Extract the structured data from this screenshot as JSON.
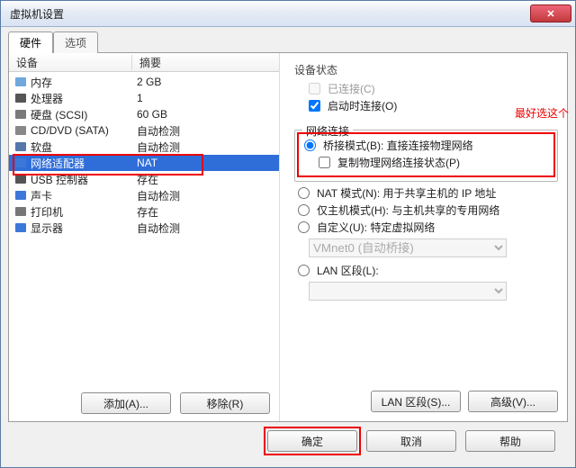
{
  "window": {
    "title": "虚拟机设置"
  },
  "tabs": [
    {
      "label": "硬件",
      "active": true
    },
    {
      "label": "选项",
      "active": false
    }
  ],
  "hardware_list": {
    "headers": {
      "device": "设备",
      "summary": "摘要"
    },
    "rows": [
      {
        "icon": "memory-icon",
        "name": "内存",
        "summary": "2 GB"
      },
      {
        "icon": "cpu-icon",
        "name": "处理器",
        "summary": "1"
      },
      {
        "icon": "disk-icon",
        "name": "硬盘 (SCSI)",
        "summary": "60 GB"
      },
      {
        "icon": "cd-icon",
        "name": "CD/DVD (SATA)",
        "summary": "自动检测"
      },
      {
        "icon": "floppy-icon",
        "name": "软盘",
        "summary": "自动检测"
      },
      {
        "icon": "nic-icon",
        "name": "网络适配器",
        "summary": "NAT",
        "selected": true
      },
      {
        "icon": "usb-icon",
        "name": "USB 控制器",
        "summary": "存在"
      },
      {
        "icon": "sound-icon",
        "name": "声卡",
        "summary": "自动检测"
      },
      {
        "icon": "printer-icon",
        "name": "打印机",
        "summary": "存在"
      },
      {
        "icon": "display-icon",
        "name": "显示器",
        "summary": "自动检测"
      }
    ],
    "buttons": {
      "add": "添加(A)...",
      "remove": "移除(R)"
    }
  },
  "right": {
    "device_state": {
      "title": "设备状态",
      "connected": {
        "label": "已连接(C)",
        "checked": false,
        "enabled": false
      },
      "connect_at_power": {
        "label": "启动时连接(O)",
        "checked": true
      }
    },
    "network": {
      "title": "网络连接",
      "annotation": "最好选这个",
      "bridged": {
        "label": "桥接模式(B): 直接连接物理网络",
        "selected": true
      },
      "replicate": {
        "label": "复制物理网络连接状态(P)",
        "checked": false
      },
      "nat": {
        "label": "NAT 模式(N): 用于共享主机的 IP 地址"
      },
      "hostonly": {
        "label": "仅主机模式(H): 与主机共享的专用网络"
      },
      "custom": {
        "label": "自定义(U): 特定虚拟网络",
        "combo": "VMnet0 (自动桥接)"
      },
      "lan": {
        "label": "LAN 区段(L):"
      }
    },
    "buttons": {
      "lan_segments": "LAN 区段(S)...",
      "advanced": "高级(V)..."
    }
  },
  "footer": {
    "ok": "确定",
    "cancel": "取消",
    "help": "帮助"
  }
}
